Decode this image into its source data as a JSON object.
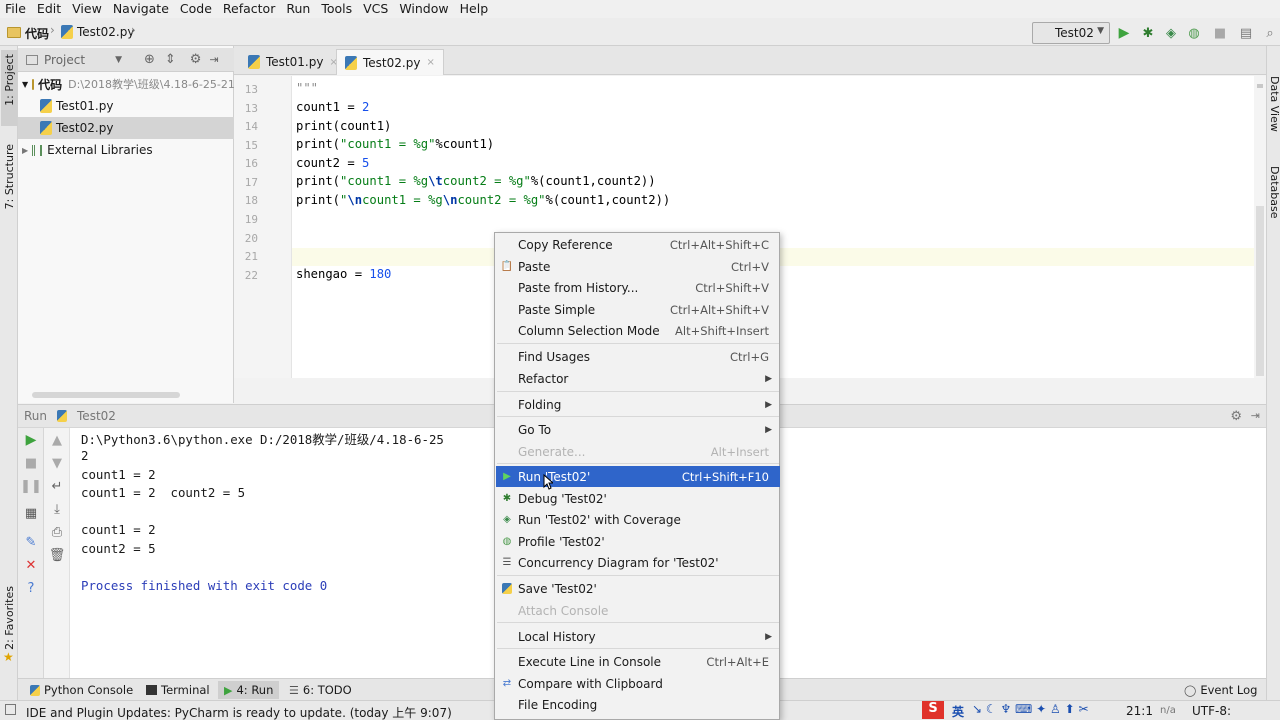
{
  "menubar": {
    "items": [
      "File",
      "Edit",
      "View",
      "Navigate",
      "Code",
      "Refactor",
      "Run",
      "Tools",
      "VCS",
      "Window",
      "Help"
    ]
  },
  "toolbar": {
    "breadcrumb_root": "代码",
    "breadcrumb_file": "Test02.py",
    "run_config": "Test02"
  },
  "left_strip": {
    "project": "1: Project",
    "structure": "7: Structure",
    "favorites": "2: Favorites"
  },
  "right_strip": {
    "data_view": "Data View",
    "database": "Database"
  },
  "project_panel": {
    "header": "Project",
    "root_name": "代码",
    "root_path": "D:\\2018教学\\班级\\4.18-6-25-21",
    "items": [
      "Test01.py",
      "Test02.py"
    ],
    "external": "External Libraries"
  },
  "editor": {
    "tabs": [
      "Test01.py",
      "Test02.py"
    ],
    "line_numbers": [
      "13",
      "13",
      "14",
      "15",
      "16",
      "17",
      "18",
      "19",
      "20",
      "21",
      "22"
    ],
    "lines": {
      "l0": "\"\"\"",
      "l1a": "count1 = ",
      "l1b": "2",
      "l2": "print(count1)",
      "l3a": "print(",
      "l3b": "\"count1 = %g\"",
      "l3c": "%count1)",
      "l4a": "count2 = ",
      "l4b": "5",
      "l5a": "print(",
      "l5b": "\"count1 = %g",
      "l5c": "\\t",
      "l5d": "count2 = %g\"",
      "l5e": "%(count1,count2))",
      "l6a": "print(",
      "l6b": "\"",
      "l6c": "\\n",
      "l6d": "count1 = %g",
      "l6e": "\\n",
      "l6f": "count2 = %g\"",
      "l6g": "%(count1,count2))",
      "l10a": "shengao = ",
      "l10b": "180"
    }
  },
  "run_panel": {
    "label": "Run",
    "config": "Test02",
    "output": [
      "D:\\Python3.6\\python.exe D:/2018教学/班级/4.18-6-25",
      "2",
      "count1 = 2",
      "count1 = 2  count2 = 5",
      "",
      "count1 = 2",
      "count2 = 5",
      "",
      "Process finished with exit code 0"
    ]
  },
  "bottom_tabs": {
    "python_console": "Python Console",
    "terminal": "Terminal",
    "run": "4: Run",
    "todo": "6: TODO",
    "event_log": "Event Log"
  },
  "statusbar": {
    "message": "IDE and Plugin Updates: PyCharm is ready to update. (today 上午 9:07)",
    "position": "21:1",
    "na": "n/a",
    "encoding": "UTF-8:",
    "ime": "英"
  },
  "context_menu": {
    "items": [
      {
        "label": "Copy Reference",
        "shortcut": "Ctrl+Alt+Shift+C"
      },
      {
        "label": "Paste",
        "shortcut": "Ctrl+V"
      },
      {
        "label": "Paste from History...",
        "shortcut": "Ctrl+Shift+V"
      },
      {
        "label": "Paste Simple",
        "shortcut": "Ctrl+Alt+Shift+V"
      },
      {
        "label": "Column Selection Mode",
        "shortcut": "Alt+Shift+Insert"
      },
      {
        "label": "Find Usages",
        "shortcut": "Ctrl+G"
      },
      {
        "label": "Refactor",
        "shortcut": ""
      },
      {
        "label": "Folding",
        "shortcut": ""
      },
      {
        "label": "Go To",
        "shortcut": ""
      },
      {
        "label": "Generate...",
        "shortcut": "Alt+Insert"
      },
      {
        "label": "Run 'Test02'",
        "shortcut": "Ctrl+Shift+F10"
      },
      {
        "label": "Debug 'Test02'",
        "shortcut": ""
      },
      {
        "label": "Run 'Test02' with Coverage",
        "shortcut": ""
      },
      {
        "label": "Profile 'Test02'",
        "shortcut": ""
      },
      {
        "label": "Concurrency Diagram for  'Test02'",
        "shortcut": ""
      },
      {
        "label": "Save 'Test02'",
        "shortcut": ""
      },
      {
        "label": "Attach Console",
        "shortcut": ""
      },
      {
        "label": "Local History",
        "shortcut": ""
      },
      {
        "label": "Execute Line in Console",
        "shortcut": "Ctrl+Alt+E"
      },
      {
        "label": "Compare with Clipboard",
        "shortcut": ""
      },
      {
        "label": "File Encoding",
        "shortcut": ""
      }
    ]
  },
  "colors": {
    "highlight": "#2f65ca",
    "run_green": "#3ea33e",
    "keyword_number": "#1750eb",
    "string": "#067d17"
  }
}
